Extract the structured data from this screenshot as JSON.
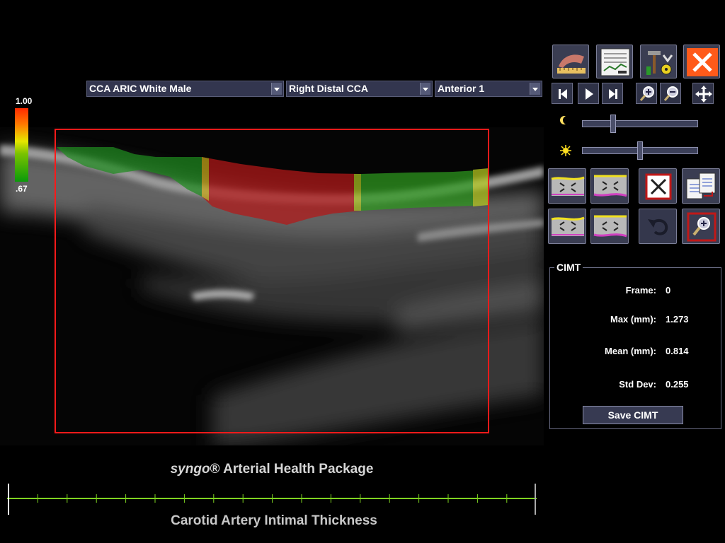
{
  "dropdowns": {
    "population": "CCA ARIC White Male",
    "segment": "Right Distal CCA",
    "view": "Anterior 1"
  },
  "color_scale": {
    "max_label": "1.00",
    "min_label": ".67",
    "colors": [
      "#ff2a00",
      "#ff7a00",
      "#e6e600",
      "#7ac200",
      "#0a9a0a"
    ]
  },
  "toolbar": {
    "row1": [
      "measure-tool-icon",
      "report-icon",
      "tools-icon",
      "close-icon"
    ],
    "playback": [
      "first-frame-icon",
      "play-icon",
      "last-frame-icon",
      "zoom-in-icon",
      "zoom-out-icon",
      "pan-icon"
    ],
    "edit_row1": [
      "edge-adjust-upper-icon",
      "edge-adjust-lower-icon",
      "delete-roi-icon",
      "copy-report-icon"
    ],
    "edit_row2": [
      "edge-adjust-upper-alt-icon",
      "edge-adjust-lower-alt-icon",
      "undo-icon",
      "zoom-roi-icon"
    ]
  },
  "sliders": {
    "brightness": {
      "icon": "moon-icon",
      "level": 0.27
    },
    "contrast": {
      "icon": "sun-icon",
      "level": 0.5
    }
  },
  "cimt": {
    "title": "CIMT",
    "frame_label": "Frame:",
    "frame_value": "0",
    "max_label": "Max (mm):",
    "max_value": "1.273",
    "mean_label": "Mean (mm):",
    "mean_value": "0.814",
    "std_label": "Std Dev:",
    "std_value": "0.255",
    "save_label": "Save CIMT"
  },
  "footer": {
    "brand_italic": "syngo",
    "brand_rest": "® Arterial Health Package",
    "title": "Carotid Artery Intimal Thickness",
    "accent_color": "#7ed321"
  }
}
